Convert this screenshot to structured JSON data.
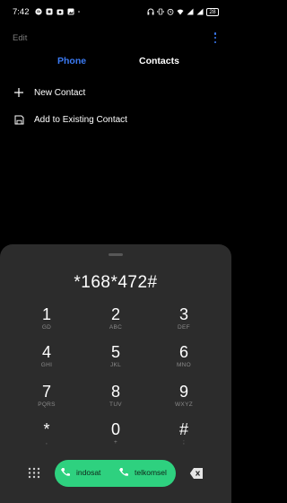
{
  "status": {
    "time": "7:42",
    "battery": "28",
    "left_icons": [
      "spotify-icon",
      "app-icon",
      "camera-icon",
      "gallery-icon",
      "dot-icon"
    ],
    "right_icons": [
      "headset-icon",
      "vibrate-icon",
      "alarm-icon",
      "wifi-icon",
      "signal-icon",
      "signal-icon"
    ]
  },
  "header": {
    "edit_label": "Edit",
    "menu_icon": "kebab-menu-icon"
  },
  "tabs": [
    {
      "label": "Phone",
      "active": true
    },
    {
      "label": "Contacts",
      "active": false
    }
  ],
  "menu": [
    {
      "label": "New Contact",
      "icon": "plus-icon"
    },
    {
      "label": "Add to Existing Contact",
      "icon": "save-contact-icon"
    }
  ],
  "dialer": {
    "number": "*168*472#",
    "keys": [
      {
        "digit": "1",
        "letters": "GD"
      },
      {
        "digit": "2",
        "letters": "ABC"
      },
      {
        "digit": "3",
        "letters": "DEF"
      },
      {
        "digit": "4",
        "letters": "GHI"
      },
      {
        "digit": "5",
        "letters": "JKL"
      },
      {
        "digit": "6",
        "letters": "MNO"
      },
      {
        "digit": "7",
        "letters": "PQRS"
      },
      {
        "digit": "8",
        "letters": "TUV"
      },
      {
        "digit": "9",
        "letters": "WXYZ"
      },
      {
        "digit": "*",
        "letters": ","
      },
      {
        "digit": "0",
        "letters": "+"
      },
      {
        "digit": "#",
        "letters": ";"
      }
    ],
    "sim1_label": "indosat",
    "sim2_label": "telkomsel",
    "colors": {
      "accent": "#3b7bf5",
      "call": "#2ed17f",
      "panel": "#2c2c2c"
    }
  }
}
